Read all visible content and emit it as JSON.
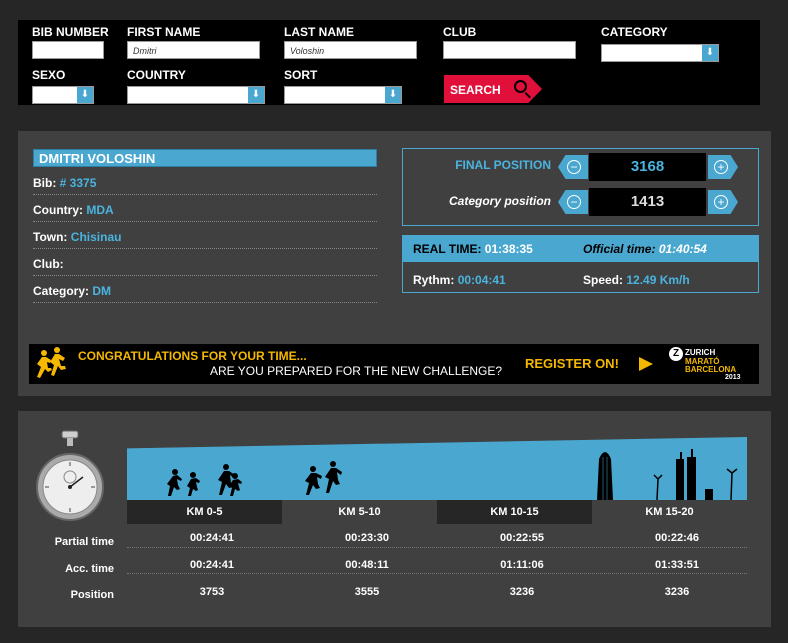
{
  "filters": {
    "bib_label": "BIB NUMBER",
    "first_name_label": "FIRST NAME",
    "first_name_value": "Dmitri",
    "last_name_label": "LAST NAME",
    "last_name_value": "Voloshin",
    "club_label": "CLUB",
    "category_label": "CATEGORY",
    "sexo_label": "SEXO",
    "country_label": "COUNTRY",
    "sort_label": "SORT",
    "search_label": "SEARCH"
  },
  "athlete": {
    "name": "DMITRI VOLOSHIN",
    "bib_label": "Bib:",
    "bib_value": "# 3375",
    "country_label": "Country:",
    "country_value": "MDA",
    "town_label": "Town:",
    "town_value": "Chisinau",
    "club_label": "Club:",
    "club_value": "",
    "category_label": "Category:",
    "category_value": "DM"
  },
  "positions": {
    "final_label": "FINAL POSITION",
    "final_value": "3168",
    "category_label": "Category position",
    "category_value": "1413"
  },
  "times": {
    "real_label": "REAL TIME:",
    "real_value": "01:38:35",
    "official_label": "Official time:",
    "official_value": "01:40:54",
    "rythm_label": "Rythm:",
    "rythm_value": "00:04:41",
    "speed_label": "Speed:",
    "speed_value": "12.49 Km/h"
  },
  "banner": {
    "line1": "CONGRATULATIONS FOR YOUR TIME...",
    "line2": "ARE YOU PREPARED FOR THE NEW CHALLENGE?",
    "cta": "REGISTER ON!",
    "logo_line1": "ZURICH",
    "logo_line2": "MARATÓ",
    "logo_line3": "BARCELONA",
    "logo_year": "2013"
  },
  "splits": {
    "headers": [
      "KM 0-5",
      "KM 5-10",
      "KM 10-15",
      "KM 15-20"
    ],
    "row_labels": [
      "Partial time",
      "Acc. time",
      "Position"
    ],
    "partial": [
      "00:24:41",
      "00:23:30",
      "00:22:55",
      "00:22:46"
    ],
    "accumulated": [
      "00:24:41",
      "00:48:11",
      "01:11:06",
      "01:33:51"
    ],
    "position": [
      "3753",
      "3555",
      "3236",
      "3236"
    ]
  },
  "colors": {
    "accent": "#4aa8d0",
    "search": "#e0103a",
    "banner_yellow": "#f5b800"
  }
}
